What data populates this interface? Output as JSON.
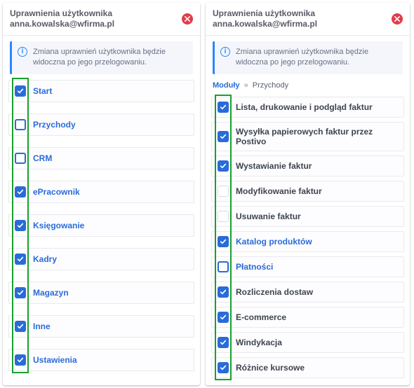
{
  "left": {
    "title": "Uprawnienia użytkownika anna.kowalska@wfirma.pl",
    "notice": "Zmiana uprawnień użytkownika będzie widoczna po jego przelogowaniu.",
    "items": [
      {
        "label": "Start",
        "state": "checked",
        "style": "link"
      },
      {
        "label": "Przychody",
        "state": "outline",
        "style": "link"
      },
      {
        "label": "CRM",
        "state": "outline",
        "style": "link"
      },
      {
        "label": "ePracownik",
        "state": "checked",
        "style": "link"
      },
      {
        "label": "Księgowanie",
        "state": "checked",
        "style": "link"
      },
      {
        "label": "Kadry",
        "state": "checked",
        "style": "link"
      },
      {
        "label": "Magazyn",
        "state": "checked",
        "style": "link"
      },
      {
        "label": "Inne",
        "state": "checked",
        "style": "link"
      },
      {
        "label": "Ustawienia",
        "state": "checked",
        "style": "link"
      }
    ]
  },
  "right": {
    "title": "Uprawnienia użytkownika anna.kowalska@wfirma.pl",
    "notice": "Zmiana uprawnień użytkownika będzie widoczna po jego przelogowaniu.",
    "breadcrumb_root": "Moduły",
    "breadcrumb_sep": "»",
    "breadcrumb_current": "Przychody",
    "items": [
      {
        "label": "Lista, drukowanie i podgląd faktur",
        "state": "checked",
        "style": "text"
      },
      {
        "label": "Wysyłka papierowych faktur przez Postivo",
        "state": "checked",
        "style": "text"
      },
      {
        "label": "Wystawianie faktur",
        "state": "checked",
        "style": "text"
      },
      {
        "label": "Modyfikowanie faktur",
        "state": "empty",
        "style": "text"
      },
      {
        "label": "Usuwanie faktur",
        "state": "empty",
        "style": "text"
      },
      {
        "label": "Katalog produktów",
        "state": "checked",
        "style": "link"
      },
      {
        "label": "Płatności",
        "state": "outline",
        "style": "link"
      },
      {
        "label": "Rozliczenia dostaw",
        "state": "checked",
        "style": "text"
      },
      {
        "label": "E-commerce",
        "state": "checked",
        "style": "text"
      },
      {
        "label": "Windykacja",
        "state": "checked",
        "style": "text"
      },
      {
        "label": "Różnice kursowe",
        "state": "checked",
        "style": "text"
      }
    ]
  },
  "icons": {
    "info_char": "i"
  },
  "colors": {
    "accent_blue": "#2a6bd8",
    "highlight_green": "#18a02e",
    "close_red": "#e23d4a"
  }
}
